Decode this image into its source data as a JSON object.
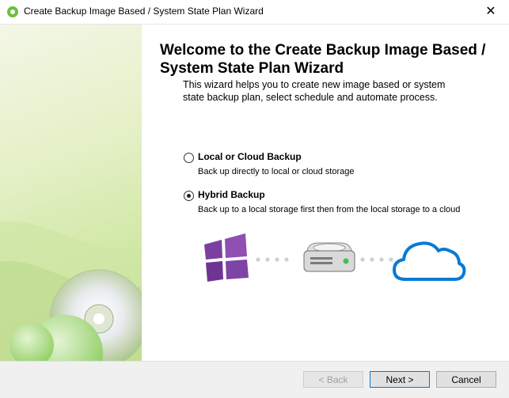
{
  "window": {
    "title": "Create Backup Image Based / System State Plan Wizard",
    "close_glyph": "✕"
  },
  "main": {
    "heading": "Welcome to the Create Backup Image Based / System State Plan Wizard",
    "intro": "This wizard helps you to create new image based or system state backup plan, select schedule and automate process.",
    "options": [
      {
        "label": "Local or Cloud Backup",
        "description": "Back up directly to local or cloud storage",
        "selected": false
      },
      {
        "label": "Hybrid Backup",
        "description": "Back up to a local storage first then from the local storage to a cloud",
        "selected": true
      }
    ],
    "illustration_icons": [
      "windows-icon",
      "hard-drive-icon",
      "cloud-icon"
    ]
  },
  "footer": {
    "back_label": "< Back",
    "next_label": "Next >",
    "cancel_label": "Cancel"
  },
  "colors": {
    "accent": "#0078d7",
    "windows_purple": "#7b3fa0",
    "cloud_blue": "#0a7ad3",
    "banner_green": "#b9dc86"
  }
}
